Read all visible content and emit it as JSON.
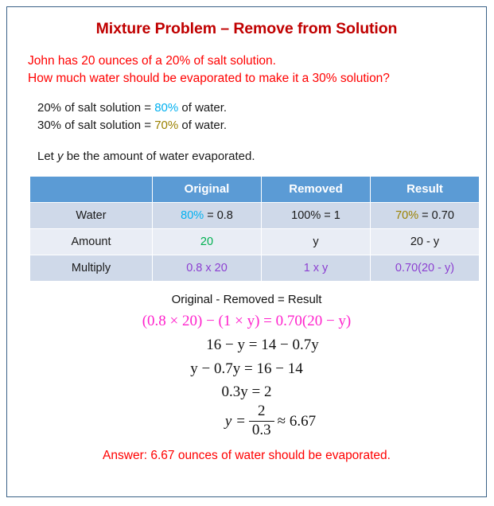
{
  "title": "Mixture Problem – Remove from Solution",
  "problem": {
    "line1": "John has 20 ounces of a 20% of salt solution.",
    "line2": "How much water should be evaporated to make it a 30% solution?"
  },
  "percent_lines": [
    {
      "prefix": "20% of salt solution = ",
      "value": "80%",
      "suffix": " of water.",
      "color": "#00b0f0"
    },
    {
      "prefix": "30% of salt solution = ",
      "value": "70%",
      "suffix": " of water.",
      "color": "#9b8100"
    }
  ],
  "let_statement": {
    "before": "Let ",
    "variable": "y",
    "after": " be the amount of water evaporated."
  },
  "table": {
    "headers": [
      "",
      "Original",
      "Removed",
      "Result"
    ],
    "rows": [
      {
        "label": "Water",
        "cells": [
          {
            "colored": "80%",
            "rest": " = 0.8",
            "color": "#00b0f0"
          },
          {
            "colored": "",
            "rest": "100% = 1",
            "color": "#1a1a1a"
          },
          {
            "colored": "70%",
            "rest": " = 0.70",
            "color": "#9b8100"
          }
        ]
      },
      {
        "label": "Amount",
        "cells": [
          {
            "colored": "20",
            "rest": "",
            "color": "#00b050"
          },
          {
            "colored": "",
            "rest": "y",
            "color": "#1a1a1a"
          },
          {
            "colored": "",
            "rest": "20 - y",
            "color": "#1a1a1a"
          }
        ]
      },
      {
        "label": "Multiply",
        "cells": [
          {
            "colored": "0.8 x 20",
            "rest": "",
            "color": "#8c3fd1"
          },
          {
            "colored": "1 x y",
            "rest": "",
            "color": "#8c3fd1"
          },
          {
            "colored": "0.70(20 - y)",
            "rest": "",
            "color": "#8c3fd1"
          }
        ]
      }
    ]
  },
  "work": {
    "relation": "Original - Removed = Result",
    "equation_main": "(0.8 × 20) − (1 × y) = 0.70(20 − y)",
    "equation_main_color": "#ff22cc",
    "step2": "16 − y = 14 − 0.7y",
    "step3": "y − 0.7y = 16 − 14",
    "step4": "0.3y = 2",
    "final": {
      "lhs": "y =",
      "numerator": "2",
      "denominator": "0.3",
      "approx": "≈ 6.67"
    }
  },
  "answer": "Answer: 6.67 ounces of water should be evaporated.",
  "colors": {
    "border": "#3a6186",
    "title_red": "#c00000",
    "body_red": "#ff0000",
    "header_blue": "#5b9bd5",
    "row_band_dark": "#cfd9e9",
    "row_band_light": "#e9edf5",
    "cyan": "#00b0f0",
    "gold": "#9b8100",
    "green": "#00b050",
    "purple": "#8c3fd1",
    "magenta": "#ff22cc"
  }
}
